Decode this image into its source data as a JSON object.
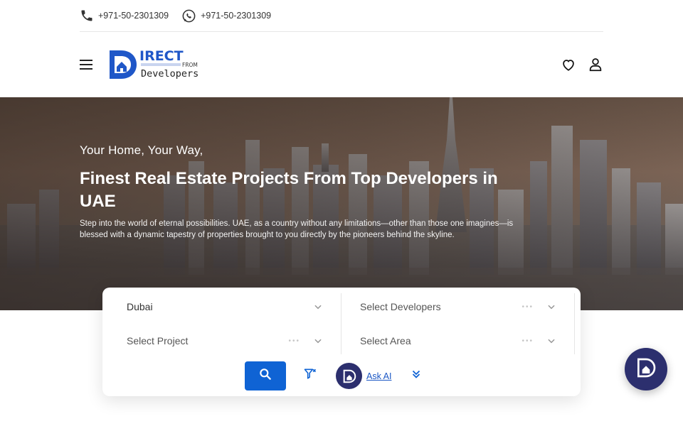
{
  "topbar": {
    "phone": {
      "icon": "phone-icon",
      "number": "+971-50-2301309"
    },
    "whatsapp": {
      "icon": "whatsapp-icon",
      "number": "+971-50-2301309"
    }
  },
  "header": {
    "menu_icon": "hamburger-menu-icon",
    "logo": {
      "line1": "IRECT",
      "from": "FROM",
      "line2": "Developers",
      "letter": "D"
    },
    "wishlist_icon": "heart-icon",
    "account_icon": "user-icon"
  },
  "hero": {
    "subtitle": "Your Home, Your Way,",
    "title": "Finest Real Estate Projects From Top Developers in UAE",
    "description": "Step into the world of eternal possibilities. UAE, as a country without any limitations—other than those one imagines—is blessed with a dynamic tapestry of properties brought to you directly by the pioneers behind the skyline."
  },
  "search": {
    "city": {
      "value": "Dubai"
    },
    "developers": {
      "placeholder": "Select Developers"
    },
    "project": {
      "placeholder": "Select Project"
    },
    "area": {
      "placeholder": "Select Area"
    },
    "dots": "•••",
    "search_icon": "search-icon",
    "clear_filter_icon": "filter-clear-icon",
    "ask_ai_label": "Ask AI",
    "expand_icon": "double-chevron-down-icon"
  },
  "colors": {
    "primary": "#0f63d4",
    "brand_dark": "#2c2f6e",
    "link": "#1a56c4"
  }
}
